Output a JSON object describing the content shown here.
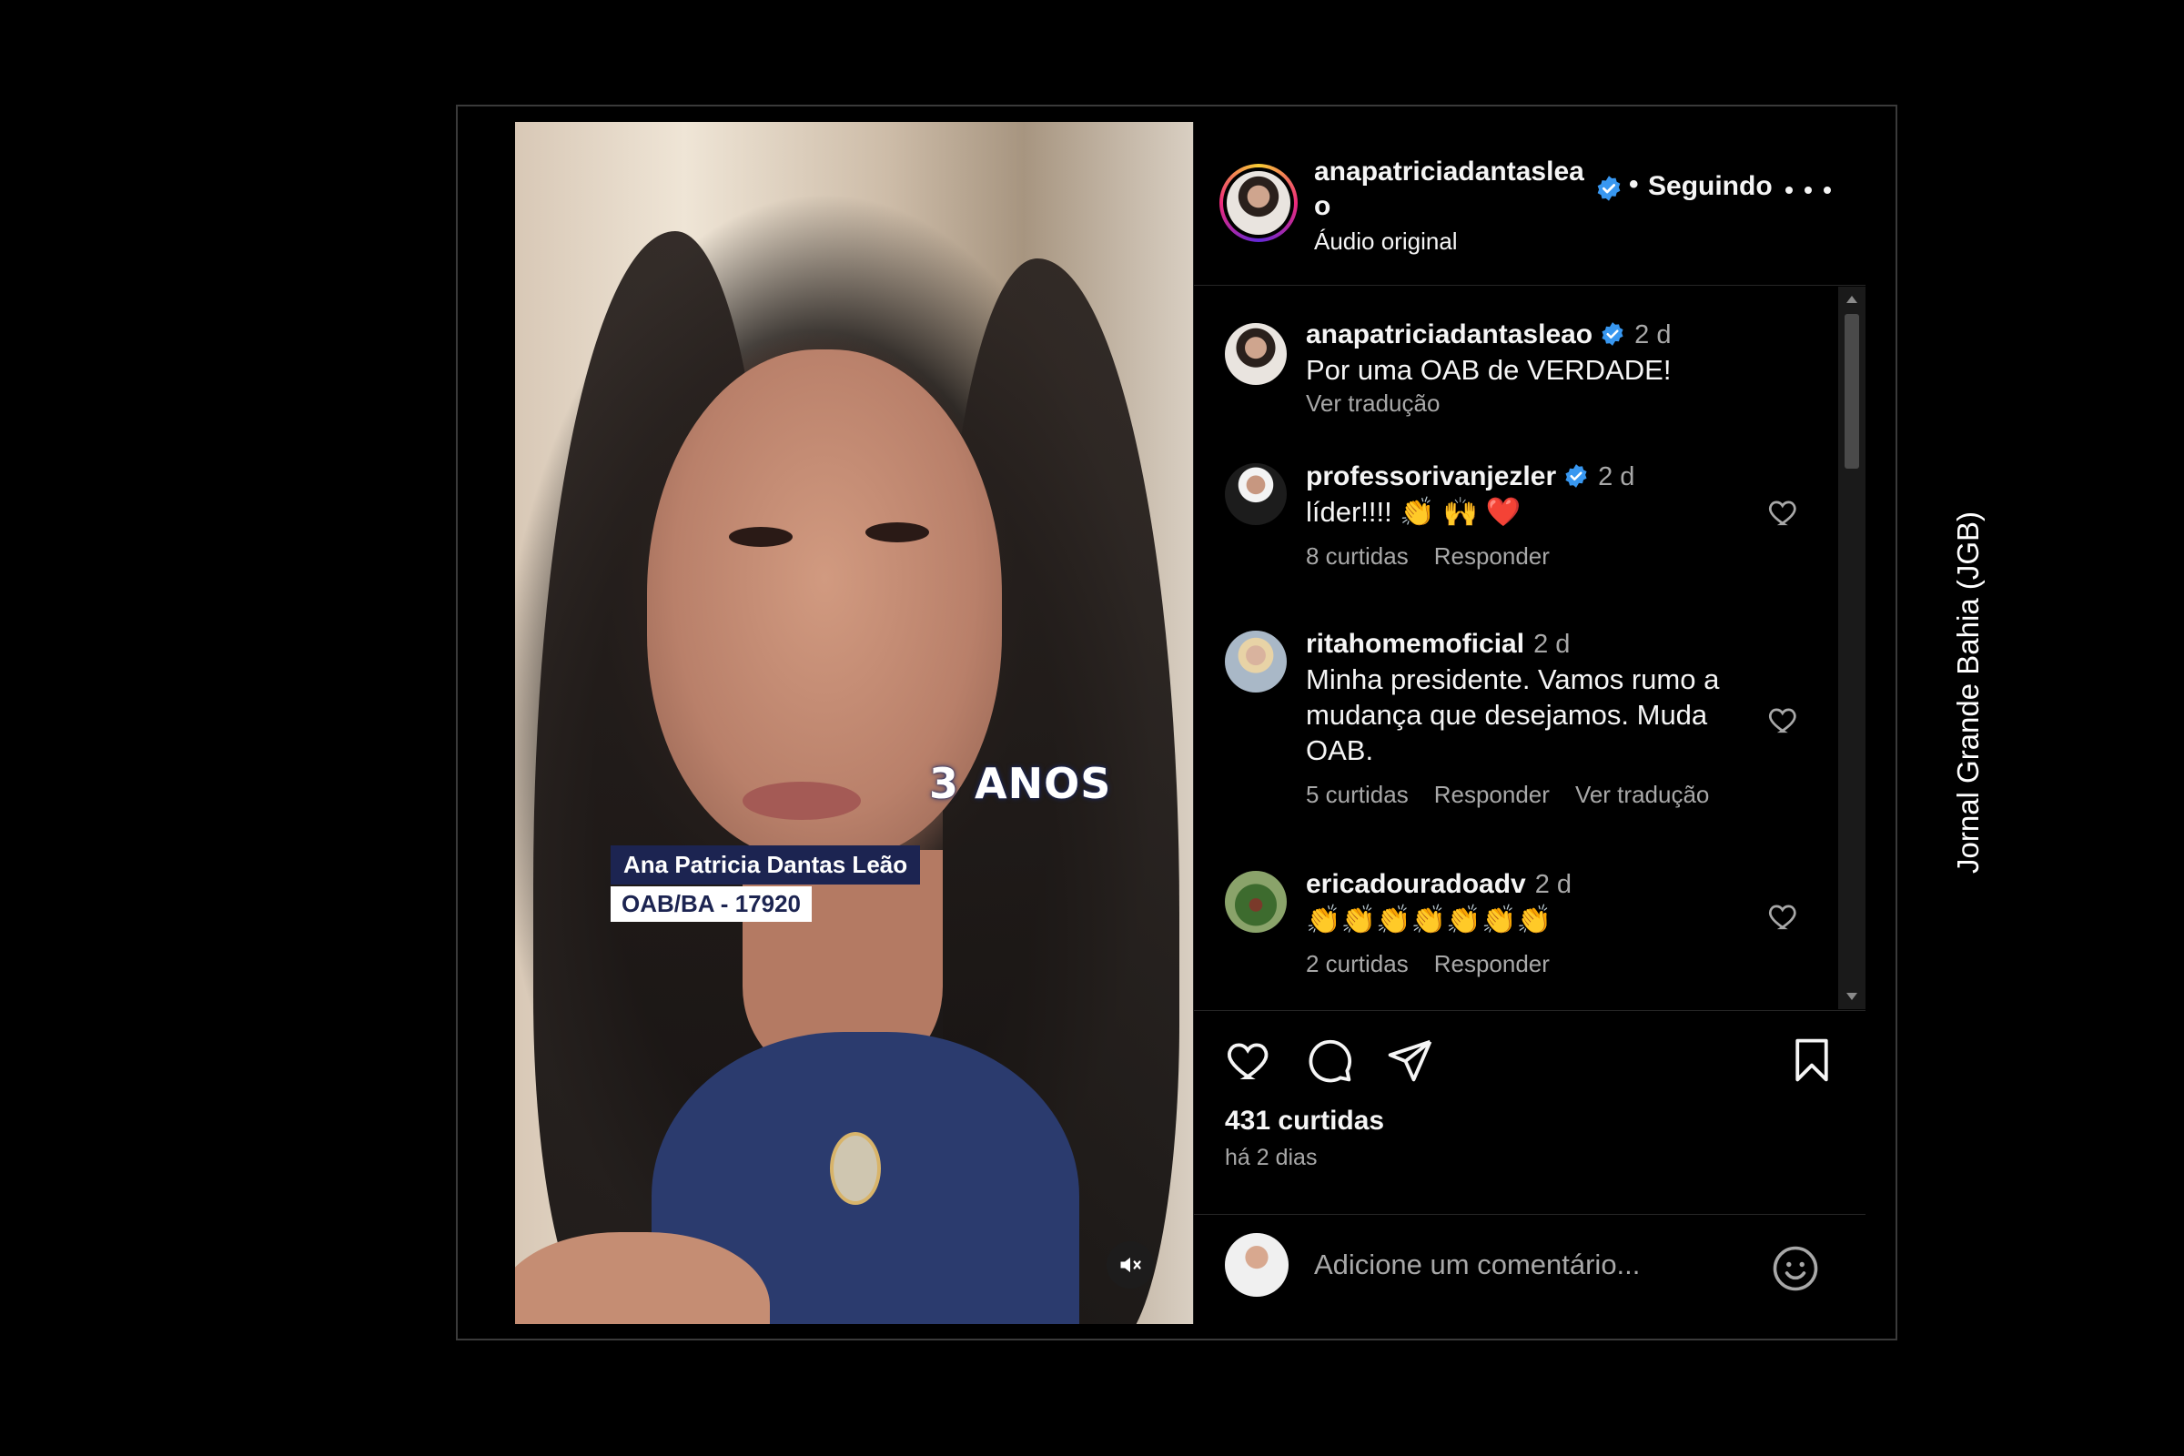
{
  "post": {
    "video": {
      "overlay_years": "3 ANOS",
      "overlay_name": "Ana Patricia Dantas Leão",
      "overlay_oab": "OAB/BA - 17920",
      "muted": true
    },
    "header": {
      "username": "anapatriciadantasleao",
      "follow_status": "Seguindo",
      "dot": "•",
      "audio": "Áudio original"
    },
    "comments": [
      {
        "user": "anapatriciadantasleao",
        "verified": true,
        "time": "2 d",
        "text": "Por uma OAB de VERDADE!",
        "sub": "Ver tradução",
        "is_caption": true
      },
      {
        "user": "professorivanjezler",
        "verified": true,
        "time": "2 d",
        "text": "líder!!!! 👏 🙌 ❤️",
        "likes": "8 curtidas",
        "reply": "Responder"
      },
      {
        "user": "ritahomemoficial",
        "verified": false,
        "time": "2 d",
        "text": "Minha presidente. Vamos rumo a mudança que desejamos. Muda OAB.",
        "likes": "5 curtidas",
        "reply": "Responder",
        "translate": "Ver tradução"
      },
      {
        "user": "ericadouradoadv",
        "verified": false,
        "time": "2 d",
        "text": "👏👏👏👏👏👏👏",
        "likes": "2 curtidas",
        "reply": "Responder"
      }
    ],
    "likes": "431 curtidas",
    "time_ago": "há 2 dias",
    "add_comment_placeholder": "Adicione um comentário..."
  },
  "credit": "Jornal Grande Bahia (JGB)",
  "colors": {
    "background": "#000000",
    "text_primary": "#f5f5f5",
    "text_secondary": "#a8a8a8",
    "verified": "#3897f0",
    "divider": "#262626"
  },
  "icons": [
    "verified-badge-icon",
    "more-options-icon",
    "heart-icon",
    "comment-icon",
    "share-icon",
    "bookmark-icon",
    "emoji-icon",
    "mute-icon"
  ]
}
